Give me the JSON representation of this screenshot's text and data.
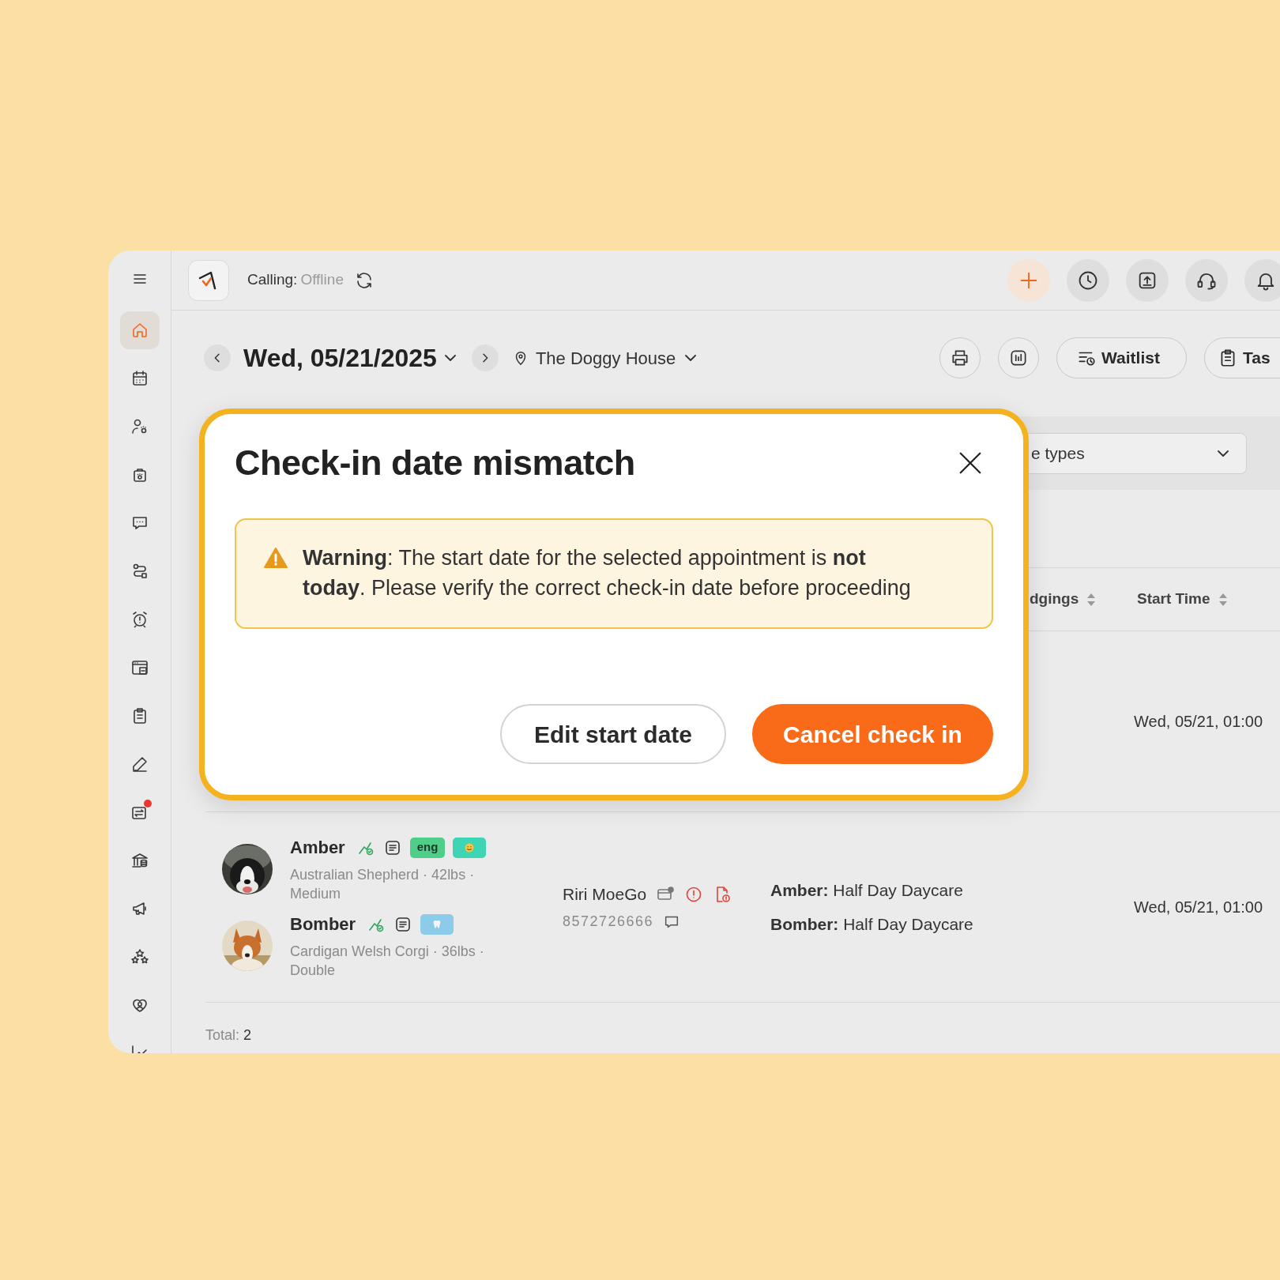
{
  "sidebar": {
    "items": [
      {
        "selected": true,
        "notification": false
      },
      {
        "selected": false,
        "notification": false
      },
      {
        "selected": false,
        "notification": false
      },
      {
        "selected": false,
        "notification": false
      },
      {
        "selected": false,
        "notification": false
      },
      {
        "selected": false,
        "notification": false
      },
      {
        "selected": false,
        "notification": false
      },
      {
        "selected": false,
        "notification": false
      },
      {
        "selected": false,
        "notification": false
      },
      {
        "selected": false,
        "notification": false
      },
      {
        "selected": false,
        "notification": true
      },
      {
        "selected": false,
        "notification": false
      },
      {
        "selected": false,
        "notification": false
      },
      {
        "selected": false,
        "notification": false
      },
      {
        "selected": false,
        "notification": false
      },
      {
        "selected": false,
        "notification": false
      }
    ]
  },
  "topbar": {
    "calling_label": "Calling:",
    "calling_status": "Offline"
  },
  "date_nav": {
    "date": "Wed, 05/21/2025",
    "location": "The Doggy House"
  },
  "toolbar": {
    "buttons": [
      {
        "label": "Waitlist"
      },
      {
        "label": "Tas"
      }
    ]
  },
  "filter": {
    "value": "e types"
  },
  "table": {
    "columns": [
      {
        "label": "dgings"
      },
      {
        "label": "Start Time"
      }
    ],
    "rows": [
      {
        "start_time": "Wed, 05/21, 01:00"
      },
      {
        "pets": [
          {
            "name": "Amber",
            "details": "Australian Shepherd · 42lbs · Medium",
            "tags": [
              {
                "label": "eng",
                "color": "#4fce8a"
              },
              {
                "color": "#3dd5b3"
              }
            ]
          },
          {
            "name": "Bomber",
            "details": "Cardigan Welsh Corgi · 36lbs · Double",
            "tags": [
              {
                "color": "#8ccbea"
              }
            ]
          }
        ],
        "client": {
          "name": "Riri MoeGo",
          "phone": "8572726666"
        },
        "services": [
          "**Amber:** Half Day Daycare",
          "**Bomber:** Half Day Daycare"
        ],
        "start_time": "Wed, 05/21, 01:00"
      }
    ]
  },
  "total": {
    "label": "Total:",
    "value": "2"
  },
  "dialog": {
    "title": "Check-in date mismatch",
    "message": "**Warning**: The start date for the selected appointment is **not today**. Please verify the correct check-in date before proceeding",
    "buttons": [
      {
        "label": "Edit start date",
        "kind": "secondary"
      },
      {
        "label": "Cancel check in",
        "kind": "primary"
      }
    ]
  }
}
